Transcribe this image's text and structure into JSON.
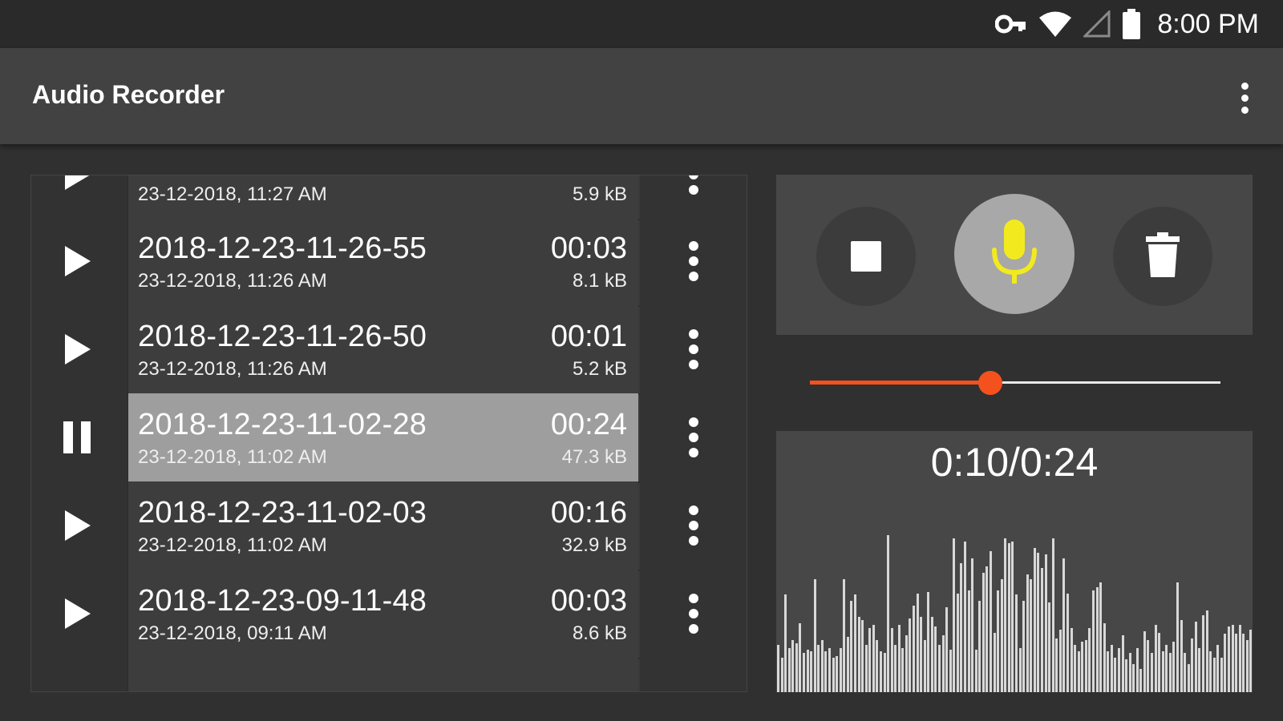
{
  "status_bar": {
    "time": "8:00 PM",
    "icons": [
      "vpn-key-icon",
      "wifi-icon",
      "cell-signal-icon",
      "battery-icon"
    ]
  },
  "app_bar": {
    "title": "Audio Recorder",
    "overflow_icon": "more-vert-icon"
  },
  "recordings": [
    {
      "name": "",
      "date": "23-12-2018, 11:27 AM",
      "duration": "",
      "size": "5.9 kB",
      "state": "play",
      "selected": false
    },
    {
      "name": "2018-12-23-11-26-55",
      "date": "23-12-2018, 11:26 AM",
      "duration": "00:03",
      "size": "8.1 kB",
      "state": "play",
      "selected": false
    },
    {
      "name": "2018-12-23-11-26-50",
      "date": "23-12-2018, 11:26 AM",
      "duration": "00:01",
      "size": "5.2 kB",
      "state": "play",
      "selected": false
    },
    {
      "name": "2018-12-23-11-02-28",
      "date": "23-12-2018, 11:02 AM",
      "duration": "00:24",
      "size": "47.3 kB",
      "state": "pause",
      "selected": true
    },
    {
      "name": "2018-12-23-11-02-03",
      "date": "23-12-2018, 11:02 AM",
      "duration": "00:16",
      "size": "32.9 kB",
      "state": "play",
      "selected": false
    },
    {
      "name": "2018-12-23-09-11-48",
      "date": "23-12-2018, 09:11 AM",
      "duration": "00:03",
      "size": "8.6 kB",
      "state": "play",
      "selected": false
    },
    {
      "name": "",
      "date": "",
      "duration": "",
      "size": "",
      "state": "none",
      "selected": false
    }
  ],
  "controls": {
    "stop_icon": "stop-icon",
    "record_icon": "microphone-icon",
    "delete_icon": "trash-icon",
    "record_color": "#f2ea1f"
  },
  "playback": {
    "position": "0:10",
    "total": "0:24",
    "readout": "0:10/0:24",
    "progress": 0.44,
    "accent_color": "#f4511e"
  },
  "waveform": {
    "bar_color": "#d8d8d8",
    "levels": [
      0.3,
      0.22,
      0.62,
      0.28,
      0.33,
      0.31,
      0.44,
      0.25,
      0.27,
      0.26,
      0.72,
      0.3,
      0.33,
      0.26,
      0.28,
      0.22,
      0.23,
      0.28,
      0.72,
      0.35,
      0.58,
      0.62,
      0.48,
      0.46,
      0.3,
      0.41,
      0.43,
      0.33,
      0.26,
      0.25,
      1.0,
      0.41,
      0.3,
      0.43,
      0.28,
      0.36,
      0.47,
      0.55,
      0.63,
      0.48,
      0.33,
      0.64,
      0.48,
      0.42,
      0.3,
      0.36,
      0.54,
      0.27,
      0.98,
      0.63,
      0.82,
      0.96,
      0.65,
      0.85,
      0.27,
      0.58,
      0.76,
      0.8,
      0.9,
      0.38,
      0.65,
      0.72,
      0.98,
      0.95,
      0.96,
      0.62,
      0.28,
      0.58,
      0.75,
      0.72,
      0.92,
      0.89,
      0.79,
      0.88,
      0.57,
      0.98,
      0.34,
      0.4,
      0.85,
      0.63,
      0.41,
      0.3,
      0.26,
      0.32,
      0.33,
      0.41,
      0.65,
      0.67,
      0.7,
      0.44,
      0.26,
      0.3,
      0.22,
      0.28,
      0.36,
      0.21,
      0.25,
      0.18,
      0.28,
      0.15,
      0.39,
      0.33,
      0.25,
      0.43,
      0.38,
      0.26,
      0.3,
      0.25,
      0.32,
      0.7,
      0.46,
      0.25,
      0.18,
      0.34,
      0.45,
      0.28,
      0.49,
      0.52,
      0.26,
      0.22,
      0.3,
      0.22,
      0.37,
      0.42,
      0.43,
      0.37,
      0.43,
      0.37,
      0.33,
      0.4
    ]
  }
}
